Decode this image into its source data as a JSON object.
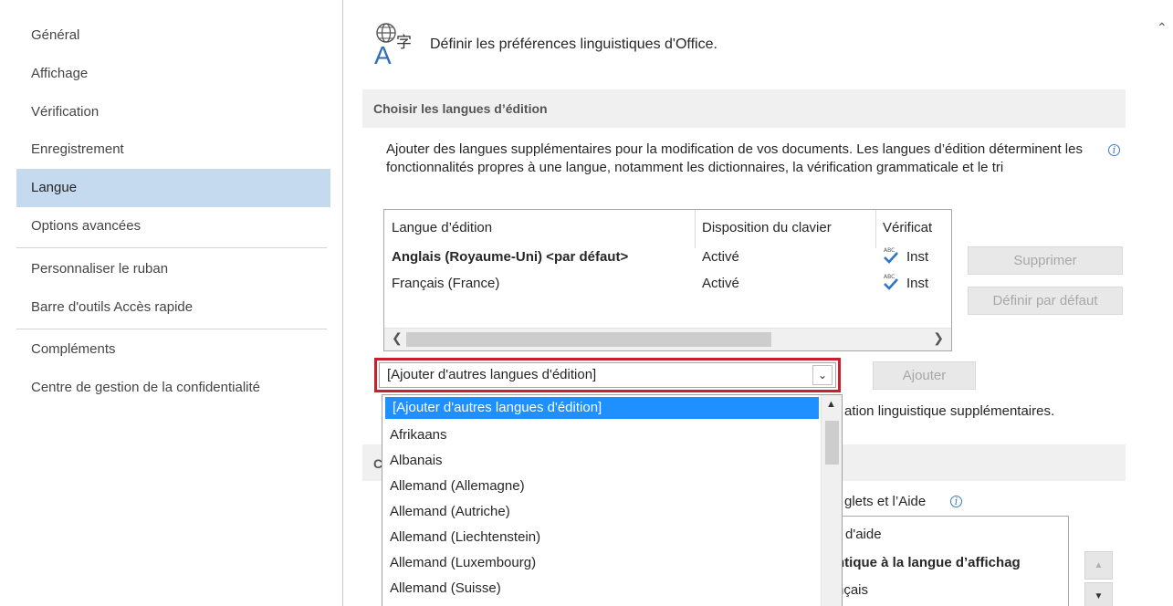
{
  "sidebar": {
    "items": [
      {
        "label": "Général"
      },
      {
        "label": "Affichage"
      },
      {
        "label": "Vérification"
      },
      {
        "label": "Enregistrement"
      },
      {
        "label": "Langue",
        "active": true
      },
      {
        "label": "Options avancées"
      },
      {
        "label": "Personnaliser le ruban"
      },
      {
        "label": "Barre d'outils Accès rapide"
      },
      {
        "label": "Compléments"
      },
      {
        "label": "Centre de gestion de la confidentialité"
      }
    ]
  },
  "main": {
    "header": "Définir les préférences linguistiques d'Office.",
    "language_icon": "language-globe-icon",
    "section_editing": {
      "title": "Choisir les langues d’édition",
      "description": "Ajouter des langues supplémentaires pour la modification de vos documents. Les langues d’édition déterminent les fonctionnalités propres à une langue, notamment les dictionnaires, la vérification grammaticale et le tri",
      "table": {
        "headers": [
          "Langue d’édition",
          "Disposition du clavier",
          "Vérificat"
        ],
        "rows": [
          {
            "language": "Anglais (Royaume-Uni) <par défaut>",
            "keyboard": "Activé",
            "proofing": "Inst",
            "bold": true
          },
          {
            "language": "Français (France)",
            "keyboard": "Activé",
            "proofing": "Inst",
            "bold": false
          }
        ]
      },
      "buttons": {
        "remove": "Supprimer",
        "set_default": "Définir par défaut",
        "add": "Ajouter"
      },
      "combo": {
        "value": "[Ajouter d'autres langues d'édition]"
      },
      "partial_line": "ation linguistique supplémentaires."
    },
    "dropdown": {
      "items": [
        "[Ajouter d'autres langues d'édition]",
        "Afrikaans",
        "Albanais",
        "Allemand (Allemagne)",
        "Allemand (Autriche)",
        "Allemand (Liechtenstein)",
        "Allemand (Luxembourg)",
        "Allemand (Suisse)"
      ],
      "selected_index": 0
    },
    "section_display": {
      "partial_header_letter": "C",
      "partial_label": "glets et l’Aide",
      "partial_rows": [
        "d'aide",
        "ntique à la langue d’affichag",
        "nçais"
      ]
    }
  },
  "colors": {
    "accent_selected": "#1e90ff",
    "sidebar_active": "#c5d9ef",
    "highlight_outline": "#c8202f",
    "info_icon": "#3a7bc8"
  }
}
